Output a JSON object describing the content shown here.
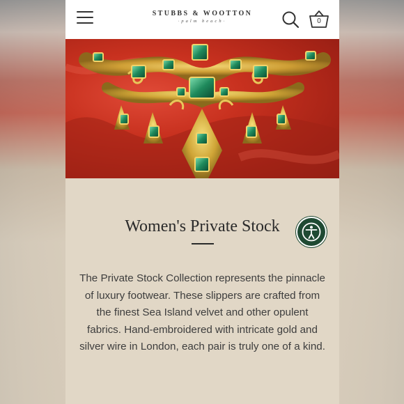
{
  "header": {
    "brand_name": "STUBBS & WOOTTON",
    "brand_sub": "palm beach",
    "cart_count": "0"
  },
  "hero": {
    "image_alt": "ornate gold and emerald jewel on red velvet"
  },
  "page": {
    "title": "Women's Private Stock",
    "description": "The Private Stock Collection represents the pinnacle of luxury footwear. These slippers are crafted from the finest Sea Island velvet and other opulent fabrics. Hand-embroidered with intricate gold and silver wire in London, each pair is truly one of a kind."
  },
  "colors": {
    "accent_green": "#1f4a33",
    "page_bg": "#e1d7c6",
    "hero_red": "#c8311f"
  }
}
